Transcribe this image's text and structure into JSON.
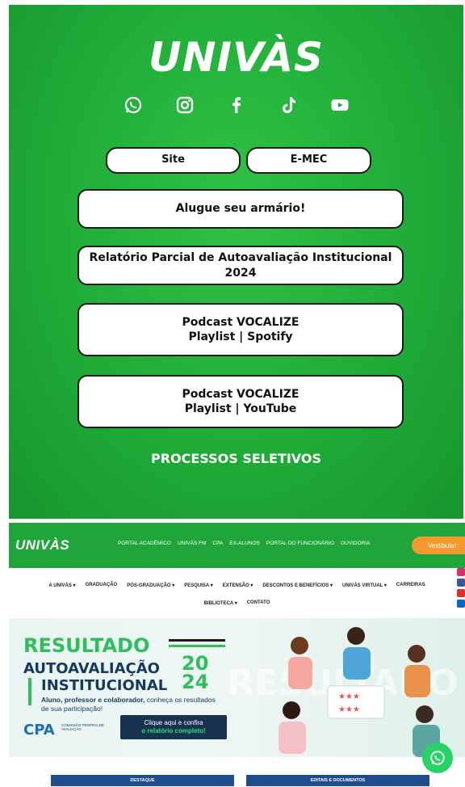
{
  "bio": {
    "logo": "UNIVÀS",
    "socials": [
      "whatsapp-icon",
      "instagram-icon",
      "facebook-icon",
      "tiktok-icon",
      "youtube-icon"
    ],
    "buttons": {
      "site": "Site",
      "emec": "E-MEC",
      "armario": "Alugue seu armário!",
      "relatorio": "Relatório Parcial de Autoavaliação Institucional 2024",
      "spotify_line1": "Podcast VOCALIZE",
      "spotify_line2": "Playlist | Spotify",
      "youtube_line1": "Podcast VOCALIZE",
      "youtube_line2": "Playlist | YouTube"
    },
    "processos": "PROCESSOS SELETIVOS"
  },
  "site": {
    "logo": "UNIVÀS",
    "top_nav": [
      "PORTAL ACADÊMICO",
      "UNIVÁS FM",
      "CPA",
      "EX-ALUNOS",
      "PORTAL DO FUNCIONÁRIO",
      "OUVIDORIA"
    ],
    "vestibular": "Vestibular",
    "main_nav": [
      "A UNIVÁS ▾",
      "GRADUAÇÃO",
      "PÓS-GRADUAÇÃO ▾",
      "PESQUISA ▾",
      "EXTENSÃO ▾",
      "DESCONTOS E BENEFÍCIOS ▾",
      "UNIVÁS VIRTUAL ▾",
      "CARREIRAS"
    ],
    "main_nav2": [
      "BIBLIOTECA ▾",
      "CONTATO"
    ],
    "banner": {
      "resultado": "RESULTADO",
      "autoavaliacao": "AUTOAVALIAÇÃO",
      "institucional": "INSTITUCIONAL",
      "year_top": "20",
      "year_bottom": "24",
      "sub_bold": "Aluno, professor e colaborador,",
      "sub_rest": " conheça os resultados de sua participação!",
      "cpa": "CPA",
      "cpa_sub": "COMISSÃO PRÓPRIA DE AVALIAÇÃO",
      "btn_line1": "Clique aqui e confira",
      "btn_line2": "o relatório completo!"
    },
    "tabs": {
      "destaque": "DESTAQUE",
      "editais": "EDITAIS E DOCUMENTOS"
    }
  }
}
